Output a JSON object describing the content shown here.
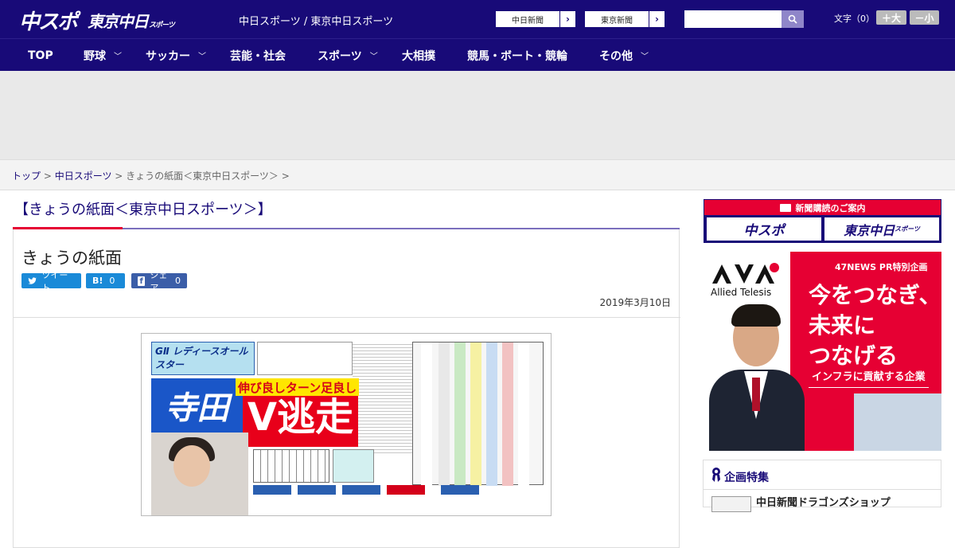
{
  "header": {
    "logo_primary": "中スポ",
    "logo_secondary": "東京中日",
    "logo_secondary_small": "スポーツ",
    "site_title": "中日スポーツ / 東京中日スポーツ",
    "paper_links": [
      {
        "label": "中日新聞"
      },
      {
        "label": "東京新聞"
      }
    ],
    "search": {
      "placeholder": ""
    },
    "font_size_label": "文字（0）",
    "font_bigger": "＋大",
    "font_smaller": "－小"
  },
  "nav": {
    "items": [
      {
        "label": "TOP"
      },
      {
        "label": "野球"
      },
      {
        "label": "サッカー"
      },
      {
        "label": "芸能・社会"
      },
      {
        "label": "スポーツ"
      },
      {
        "label": "大相撲"
      },
      {
        "label": "競馬・ボート・競輪"
      },
      {
        "label": "その他"
      }
    ]
  },
  "breadcrumb": {
    "home": "トップ",
    "sep1": " > ",
    "parent": "中日スポーツ",
    "sep2": " > ",
    "current": "きょうの紙面＜東京中日スポーツ＞",
    "sep3": " > "
  },
  "main": {
    "section_title": "【きょうの紙面＜東京中日スポーツ＞】",
    "article_title": "きょうの紙面",
    "share": {
      "tweet": "ツイート",
      "hatena_label": "B!",
      "hatena_count": "0",
      "fb_label": "シェア",
      "fb_count": "0"
    },
    "date": "2019年3月10日",
    "paper_image": {
      "header_label": "GⅡ レディースオールスター",
      "headline_name": "寺田",
      "headline_banner": "伸び良しターン足良し",
      "headline_main": "V逃走"
    }
  },
  "sidebar": {
    "subscription": {
      "header": "新聞購読のご案内",
      "logo1": "中スポ",
      "logo2": "東京中日",
      "logo2_small": "スポーツ"
    },
    "ad": {
      "brand": "Allied Telesis",
      "tag": "47NEWS PR特別企画",
      "copy_line1": "今をつなぎ、",
      "copy_line2": "未来に",
      "copy_line3": "つなげる",
      "sub": "インフラに貢献する企業"
    },
    "feature": {
      "title": "企画特集",
      "first_item": "中日新聞ドラゴンズショップ"
    }
  },
  "colors": {
    "brand_navy": "#180a78",
    "accent_red": "#e60033",
    "accent_purple": "#7b6fbd",
    "share_blue": "#1a8ad8",
    "fb_blue": "#3b5ea8"
  }
}
